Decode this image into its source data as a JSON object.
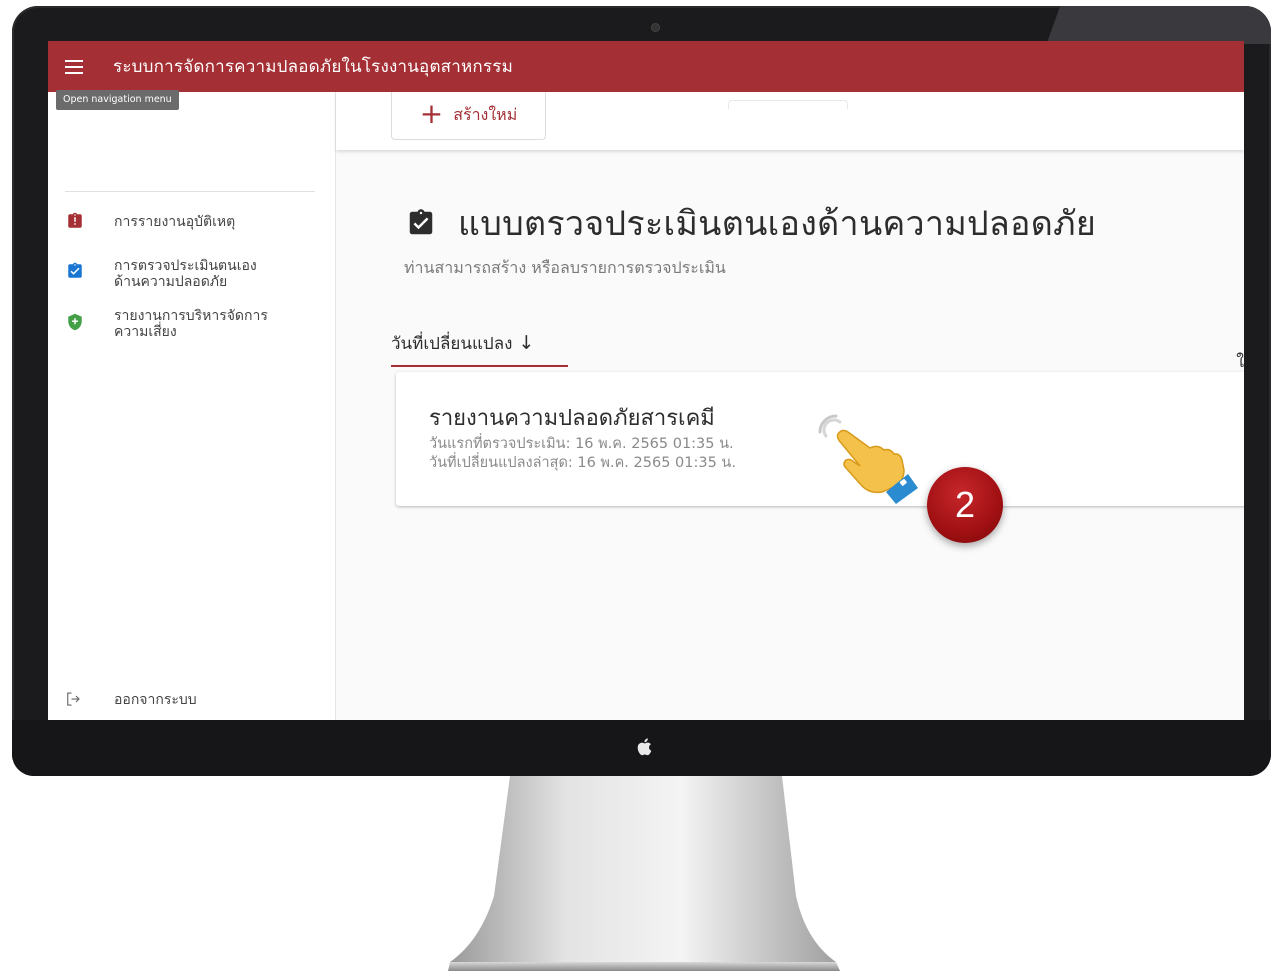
{
  "app": {
    "title": "ระบบการจัดการความปลอดภัยในโรงงานอุตสาหกรรม",
    "tooltip": "Open navigation menu"
  },
  "sidebar": {
    "items": [
      {
        "label": "การรายงานอุบัติเหตุ",
        "icon": "clipboard-alert-icon"
      },
      {
        "label": "การตรวจประเมินตนเอง\nด้านความปลอดภัย",
        "icon": "clipboard-check-icon"
      },
      {
        "label": "รายงานการบริหารจัดการ\nความเสี่ยง",
        "icon": "shield-plus-icon"
      }
    ],
    "logout_label": "ออกจากระบบ"
  },
  "toolbar": {
    "create_label": "สร้างใหม่"
  },
  "page": {
    "title": "แบบตรวจประเมินตนเองด้านความปลอดภัย",
    "subtitle": "ท่านสามารถสร้าง หรือลบรายการตรวจประเมิน"
  },
  "sort": {
    "label": "วันที่เปลี่ยนแปลง",
    "arrow": "↓"
  },
  "edge_glyph": "ใ",
  "report": {
    "title": "รายงานความปลอดภัยสารเคมี",
    "first_assessed": "วันแรกที่ตรวจประเมิน: 16 พ.ค. 2565 01:35 น.",
    "last_modified": "วันที่เปลี่ยนแปลงล่าสุด: 16 พ.ค. 2565 01:35 น."
  },
  "overlay": {
    "step_number": "2"
  },
  "colors": {
    "brand": "#a42f34",
    "accent_blue": "#1976d2",
    "accent_green": "#43a047"
  }
}
